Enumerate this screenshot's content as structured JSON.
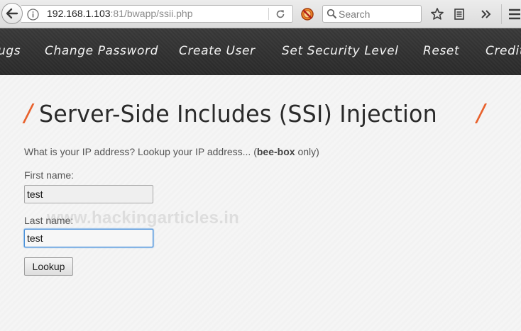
{
  "browser": {
    "url_host": "192.168.1.103",
    "url_path": ":81/bwapp/ssii.php",
    "search_placeholder": "Search"
  },
  "nav": {
    "items": [
      {
        "label": "ugs"
      },
      {
        "label": "Change Password"
      },
      {
        "label": "Create User"
      },
      {
        "label": "Set Security Level"
      },
      {
        "label": "Reset"
      },
      {
        "label": "Credit"
      }
    ]
  },
  "page": {
    "title_slash_left": "/",
    "title": "Server-Side Includes (SSI) Injection",
    "title_slash_right": "/",
    "desc_prefix": "What is your IP address? Lookup your IP address... (",
    "desc_bold": "bee-box",
    "desc_suffix": " only)",
    "first_name_label": "First name:",
    "first_name_value": "test",
    "last_name_label": "Last name:",
    "last_name_value": "test",
    "lookup_label": "Lookup",
    "watermark": "www.hackingarticles.in"
  },
  "colors": {
    "accent": "#e8612c",
    "nav_bg": "#2f2f2f",
    "focus_border": "#4a90d9"
  },
  "icons": [
    "back-arrow-icon",
    "info-icon",
    "reload-icon",
    "extension-icon",
    "search-icon",
    "star-icon",
    "reading-list-icon",
    "overflow-chevrons-icon",
    "hamburger-menu-icon"
  ]
}
